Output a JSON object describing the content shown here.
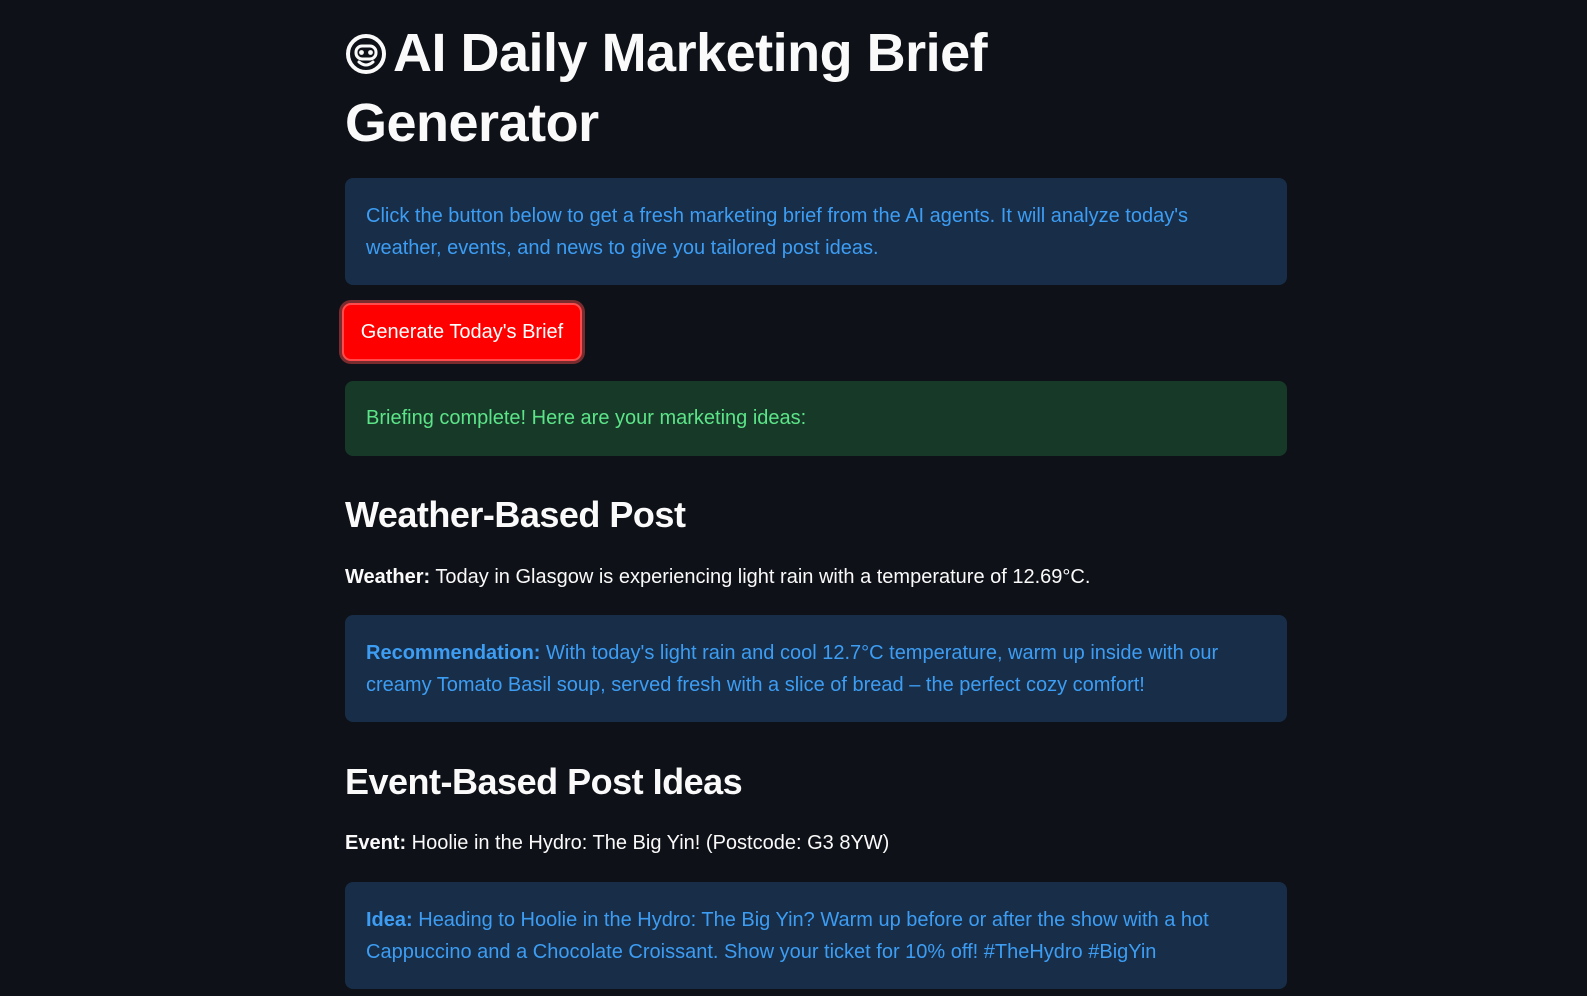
{
  "header": {
    "title_icon": "robot-face-icon",
    "title": "AI Daily Marketing Brief Generator"
  },
  "intro": {
    "text": "Click the button below to get a fresh marketing brief from the AI agents. It will analyze today's weather, events, and news to give you tailored post ideas."
  },
  "actions": {
    "generate_label": "Generate Today's Brief"
  },
  "status": {
    "success_text": "Briefing complete! Here are your marketing ideas:"
  },
  "weather_section": {
    "heading": "Weather-Based Post",
    "weather_label": "Weather:",
    "weather_text": " Today in Glasgow is experiencing light rain with a temperature of 12.69°C.",
    "recommendation_label": "Recommendation:",
    "recommendation_text": " With today's light rain and cool 12.7°C temperature, warm up inside with our creamy Tomato Basil soup, served fresh with a slice of bread – the perfect cozy comfort!"
  },
  "event_section": {
    "heading": "Event-Based Post Ideas",
    "event_label": "Event:",
    "event_text": " Hoolie in the Hydro: The Big Yin! (Postcode: G3 8YW)",
    "idea_label": "Idea:",
    "idea_text": " Heading to Hoolie in the Hydro: The Big Yin? Warm up before or after the show with a hot Cappuccino and a Chocolate Croissant. Show your ticket for 10% off! #TheHydro #BigYin"
  },
  "colors": {
    "background": "#0e1117",
    "info_bg": "#172d48",
    "info_text": "#3d9df3",
    "success_bg": "#173928",
    "success_text": "#5ce488",
    "button_bg": "#ff0000"
  }
}
